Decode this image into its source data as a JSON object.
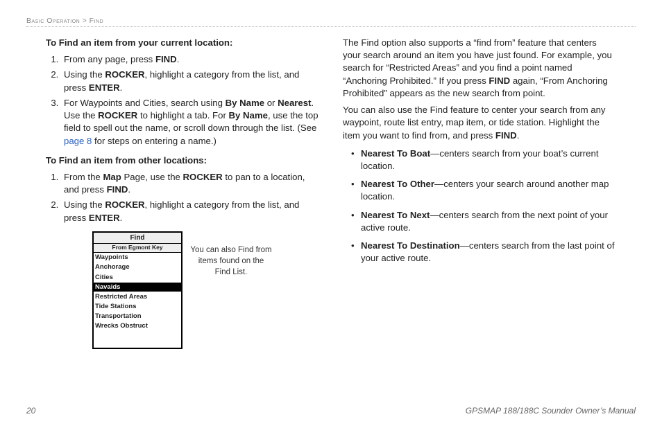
{
  "breadcrumb": "Basic Operation > Find",
  "left": {
    "h1": "To Find an item from your current location:",
    "steps1": [
      "From any page, press <b>FIND</b>.",
      "Using the <b>ROCKER</b>, highlight a category from the list, and press <b>ENTER</b>.",
      "For Waypoints and Cities, search using <b>By Name</b> or <b>Nearest</b>. Use the <b>ROCKER</b> to highlight a tab. For <b>By Name</b>, use the top field to spell out the name, or scroll down through the list. (See <span class='link'>page 8</span> for steps on entering a name.)"
    ],
    "h2": "To Find an item from other locations:",
    "steps2": [
      "From the <b>Map</b> Page, use the <b>ROCKER</b> to pan to a location, and press <b>FIND</b>.",
      "Using the <b>ROCKER</b>, highlight a category from the list, and press <b>ENTER</b>."
    ],
    "shot": {
      "title": "Find",
      "sub": "From Egmont Key",
      "items": [
        "Waypoints",
        "Anchorage",
        "Cities",
        "Navaids",
        "Restricted Areas",
        "Tide Stations",
        "Transportation",
        "Wrecks Obstruct"
      ],
      "selected_index": 3
    },
    "caption": "You can also Find from items found on the Find List."
  },
  "right": {
    "p1": "The Find option also supports a “find from” feature that centers your search around an item you have just found. For example, you search for “Restricted Areas” and you find a point named “Anchoring Prohibited.” If you press <b>FIND</b> again, “From Anchoring Prohibited” appears as the new search from point.",
    "p2": "You can also use the Find feature to center your search from any waypoint, route list entry, map item, or tide station. Highlight the item you want to find from, and press <b>FIND</b>.",
    "bullets": [
      "<b>Nearest To Boat</b>—centers search from your boat’s current location.",
      "<b>Nearest To Other</b>—centers your search around another map location.",
      "<b>Nearest To Next</b>—centers search from the next point of your active route.",
      "<b>Nearest To Destination</b>—centers search from the last point of your active route."
    ]
  },
  "footer": {
    "page": "20",
    "manual": "GPSMAP 188/188C Sounder Owner’s Manual"
  }
}
